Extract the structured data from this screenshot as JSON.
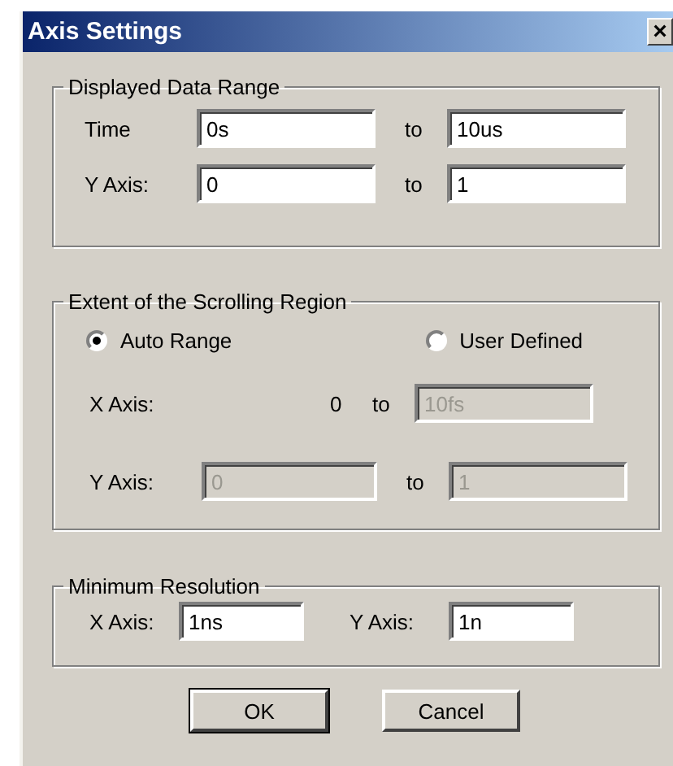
{
  "window": {
    "title": "Axis Settings",
    "close": "×"
  },
  "displayed_range": {
    "title": "Displayed Data Range",
    "rows": [
      {
        "label": "Time",
        "from": {
          "value": "0s",
          "disabled": false
        },
        "to_label": "to",
        "to": {
          "value": "10us",
          "disabled": false
        }
      },
      {
        "label": "Y Axis:",
        "from": {
          "value": "0",
          "disabled": false
        },
        "to_label": "to",
        "to": {
          "value": "1",
          "disabled": false
        }
      }
    ]
  },
  "scrolling_region": {
    "title": "Extent of the Scrolling Region",
    "options": [
      {
        "label": "Auto Range",
        "selected": true
      },
      {
        "label": "User Defined",
        "selected": false
      }
    ],
    "x_row": {
      "label": "X Axis:",
      "from_text": "0",
      "to_label": "to",
      "to": {
        "value": "10fs",
        "disabled": true
      }
    },
    "y_row": {
      "label": "Y Axis:",
      "from": {
        "value": "0",
        "disabled": true
      },
      "to_label": "to",
      "to": {
        "value": "1",
        "disabled": true
      }
    }
  },
  "min_resolution": {
    "title": "Minimum Resolution",
    "fields": [
      {
        "label": "X Axis:",
        "value": "1ns",
        "disabled": false
      },
      {
        "label": "Y Axis:",
        "value": "1n",
        "disabled": false
      }
    ]
  },
  "buttons": [
    {
      "label": "OK",
      "default": true
    },
    {
      "label": "Cancel",
      "default": false
    }
  ]
}
